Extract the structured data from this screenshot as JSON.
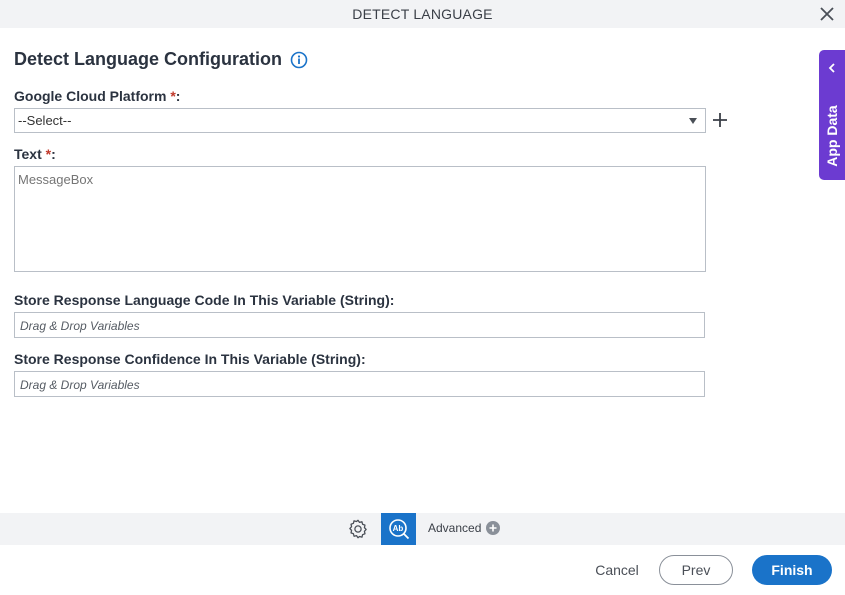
{
  "window": {
    "title": "DETECT LANGUAGE"
  },
  "form": {
    "heading": "Detect Language Configuration",
    "gcp": {
      "label": "Google Cloud Platform",
      "required_mark": "*",
      "colon": ":",
      "selected": "--Select--"
    },
    "text": {
      "label": "Text",
      "required_mark": "*",
      "colon": ":",
      "placeholder": "MessageBox"
    },
    "language_code_var": {
      "label": "Store Response Language Code In This Variable (String):",
      "placeholder": "Drag & Drop Variables"
    },
    "confidence_var": {
      "label": "Store Response Confidence In This Variable (String):",
      "placeholder": "Drag & Drop Variables"
    }
  },
  "side_panel": {
    "label": "App Data"
  },
  "toolbar": {
    "advanced_label": "Advanced"
  },
  "footer": {
    "cancel_label": "Cancel",
    "prev_label": "Prev",
    "finish_label": "Finish"
  },
  "colors": {
    "accent": "#1a73c9",
    "side_panel": "#6c3bd1",
    "required": "#c0392b"
  }
}
